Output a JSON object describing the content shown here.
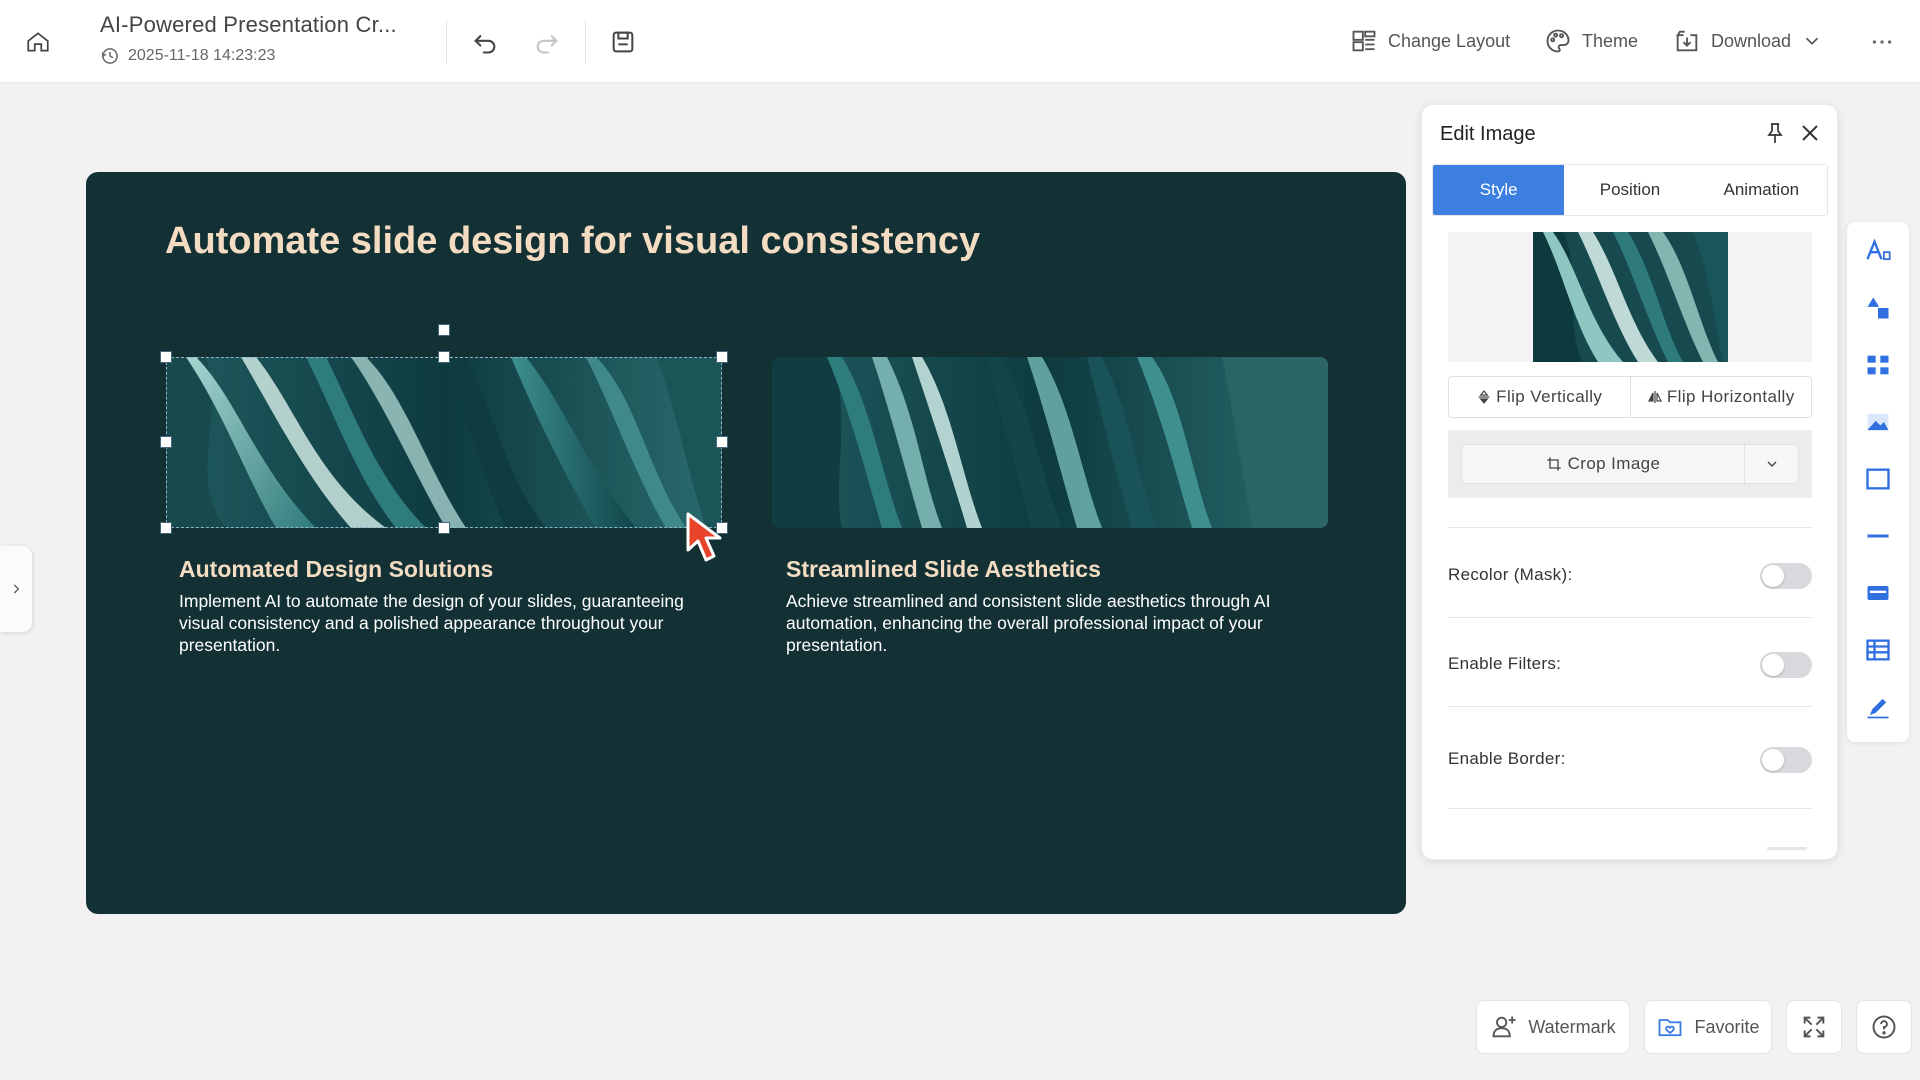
{
  "header": {
    "doc_title": "AI-Powered Presentation Cr...",
    "timestamp": "2025-11-18 14:23:23",
    "change_layout": "Change Layout",
    "theme": "Theme",
    "download": "Download"
  },
  "slide": {
    "title": "Automate slide design for visual consistency",
    "cards": [
      {
        "title": "Automated Design Solutions",
        "description": "Implement AI to automate the design of your slides, guaranteeing visual consistency and a polished appearance throughout your presentation."
      },
      {
        "title": "Streamlined Slide Aesthetics",
        "description": "Achieve streamlined and consistent slide aesthetics through AI automation, enhancing the overall professional impact of your presentation."
      }
    ]
  },
  "panel": {
    "title": "Edit Image",
    "tabs": [
      "Style",
      "Position",
      "Animation"
    ],
    "active_tab": "Style",
    "flip_vertically": "Flip Vertically",
    "flip_horizontally": "Flip Horizontally",
    "crop_image": "Crop Image",
    "recolor": "Recolor (Mask):",
    "filters": "Enable Filters:",
    "border": "Enable Border:"
  },
  "toggles": {
    "recolor": false,
    "filters": false,
    "border": false
  },
  "footer": {
    "watermark": "Watermark",
    "favorite": "Favorite"
  },
  "colors": {
    "accent": "#3d7fe0",
    "slide_bg": "#133135",
    "slide_heading": "#f4dcc2",
    "cursor": "#e8442a"
  }
}
